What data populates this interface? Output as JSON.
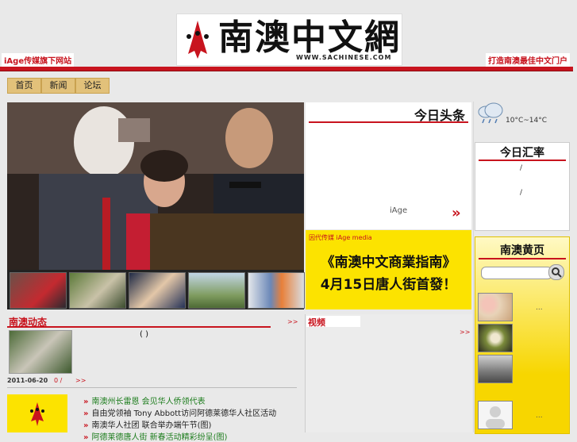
{
  "header": {
    "logo_text": "南澳中文網",
    "logo_url": "WWW.SACHINESE.COM",
    "tag_left": "iAge传媒旗下网站",
    "tag_right": "打造南澳最佳中文门户"
  },
  "tabs": [
    "首页",
    "新闻",
    "论坛"
  ],
  "headline": {
    "title": "今日头条",
    "source": "iAge",
    "next_arrow": "»"
  },
  "ad": {
    "brand": "因代传媒 iAge media",
    "line1": "《南澳中文商業指南》",
    "line2": "4月15日唐人街首發！"
  },
  "weather": {
    "temp": "10°C~14°C"
  },
  "rate": {
    "title": "今日汇率",
    "value1": "/",
    "value2": "/"
  },
  "yellow_pages": {
    "title": "南澳黄页",
    "dots": [
      "...",
      "...",
      "..."
    ]
  },
  "news": {
    "title": "南澳动态",
    "more": ">>",
    "caption": "(   )",
    "date": "2011-06-20",
    "count": "0",
    "sep": "/",
    "more2": ">>",
    "items": [
      {
        "text": "南澳州长雷恩 会见华人侨领代表",
        "green": true
      },
      {
        "text": "自由党领袖 Tony Abbott访问阿德莱德华人社区活动",
        "green": false
      },
      {
        "text": "南澳华人社团 联合举办端午节(图)",
        "green": false
      },
      {
        "text": "阿德莱德唐人街 新春活动精彩纷呈(图)",
        "green": true
      }
    ]
  },
  "video": {
    "title": "视频",
    "more": ">>"
  },
  "colors": {
    "brand_red": "#c8141e",
    "tab_gold": "#e2c17a",
    "ad_yellow": "#fce300"
  }
}
